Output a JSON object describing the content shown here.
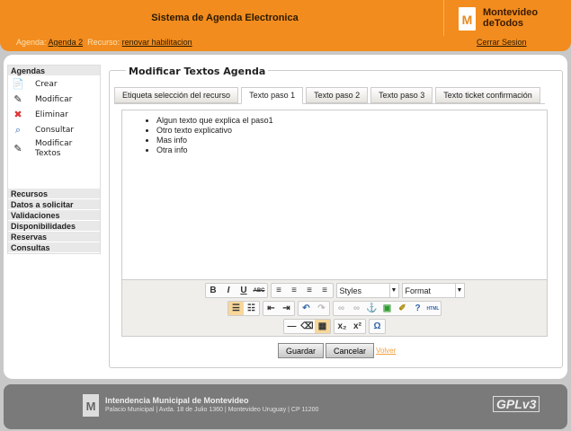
{
  "header": {
    "title": "Sistema de Agenda Electronica",
    "logo_line1": "Montevideo",
    "logo_line2": "deTodos",
    "logo_mark": "M",
    "agenda_label": "Agenda:",
    "agenda_value": "Agenda 2",
    "recurso_label": "Recurso:",
    "recurso_value": "renovar habilitacion",
    "logout": "Cerrar Sesion"
  },
  "sidebar": {
    "section": "Agendas",
    "items": [
      {
        "label": "Crear",
        "icon": "new-doc-icon"
      },
      {
        "label": "Modificar",
        "icon": "edit-icon"
      },
      {
        "label": "Eliminar",
        "icon": "delete-icon"
      },
      {
        "label": "Consultar",
        "icon": "search-icon"
      },
      {
        "label": "Modificar Textos",
        "icon": "edit-text-icon"
      }
    ],
    "sections": [
      "Recursos",
      "Datos a solicitar",
      "Validaciones",
      "Disponibilidades",
      "Reservas",
      "Consultas"
    ]
  },
  "main": {
    "legend": "Modificar Textos Agenda",
    "tabs": [
      "Etiqueta selección del recurso",
      "Texto paso 1",
      "Texto paso 2",
      "Texto paso 3",
      "Texto ticket confirmación"
    ],
    "active_tab": 1,
    "editor_items": [
      "Algun texto que explica el paso1",
      "Otro texto explicativo",
      "Mas info",
      "Otra info"
    ],
    "styles_select": "Styles",
    "format_select": "Format",
    "save": "Guardar",
    "cancel": "Cancelar",
    "back": "Volver"
  },
  "footer": {
    "org": "Intendencia Municipal de Montevideo",
    "address": "Palacio Municipal | Avda. 18 de Julio 1360 | Montevideo Uruguay | CP 11200",
    "logo_mark": "M",
    "gpl": "GPLv3"
  }
}
